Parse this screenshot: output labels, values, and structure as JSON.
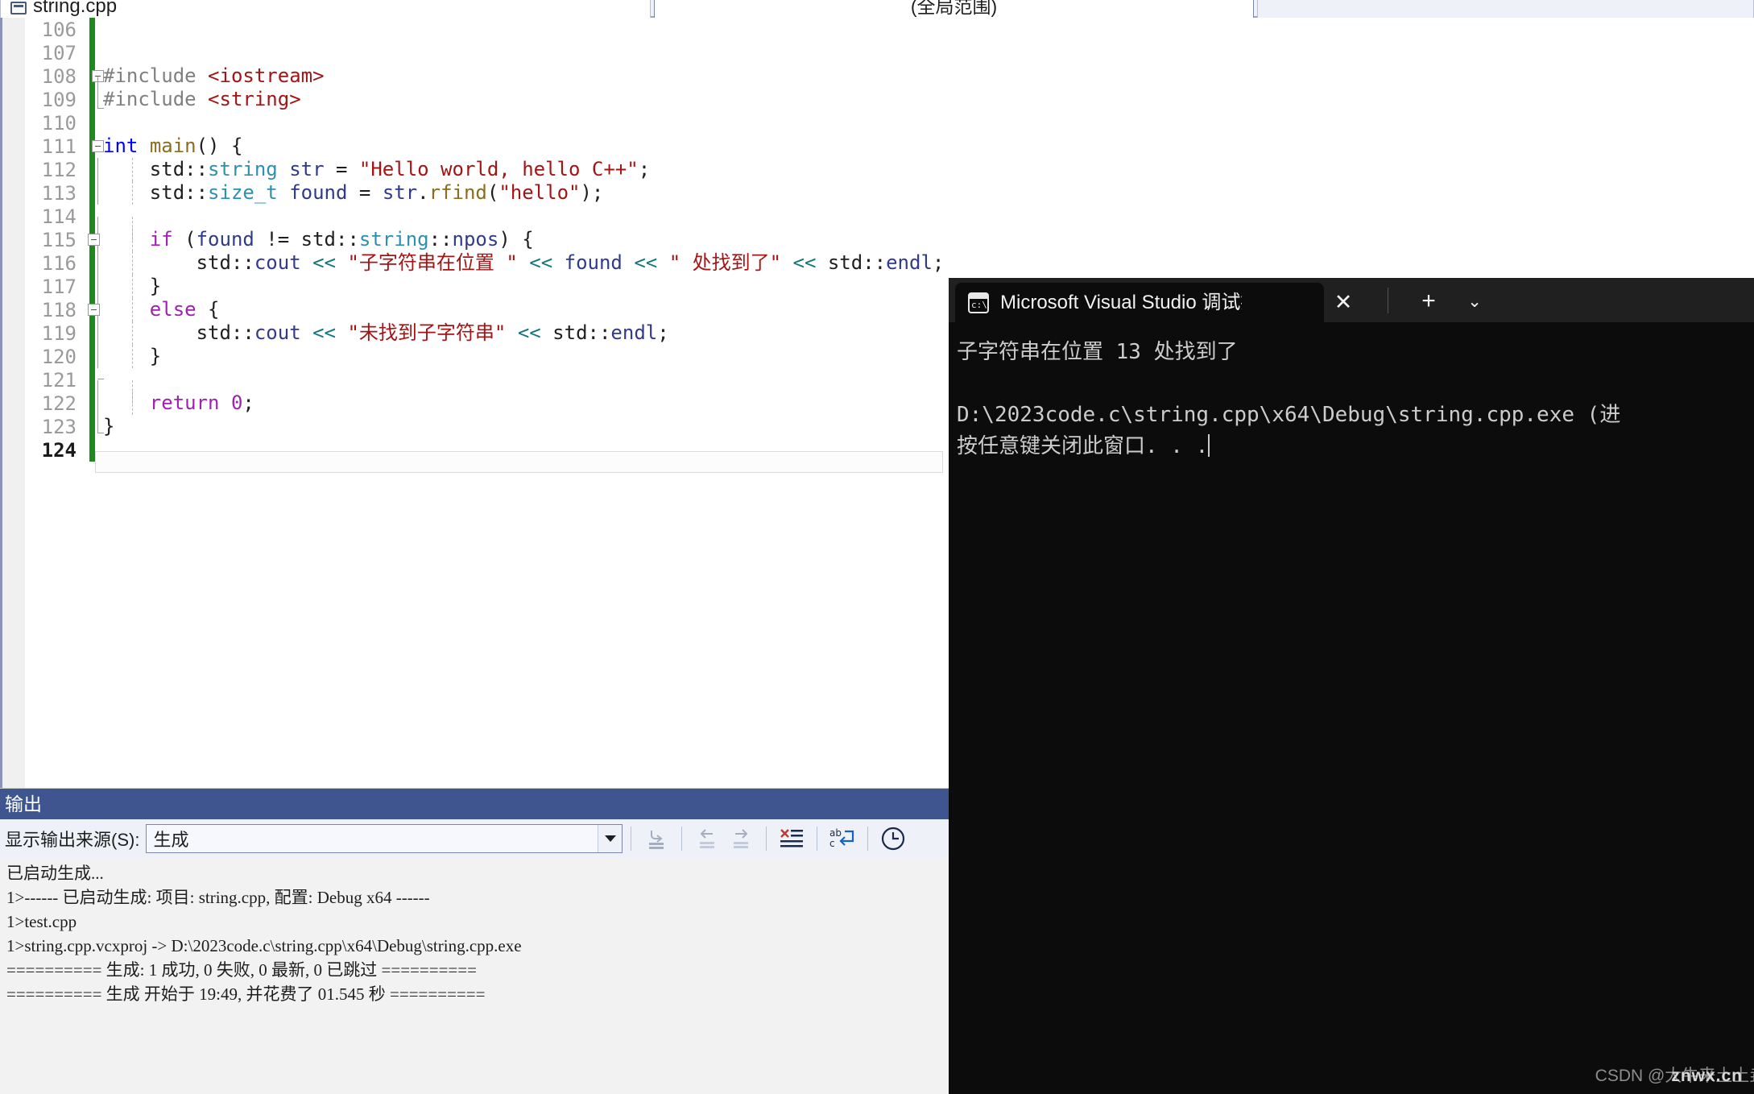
{
  "tabstrip": {
    "document_tab": "string.cpp",
    "scope_selector": "(全局范围)",
    "doc_icon": "cpp-file-icon"
  },
  "editor": {
    "lines": [
      {
        "no": "106",
        "code": ""
      },
      {
        "no": "107",
        "code": ""
      },
      {
        "no": "108",
        "code": "#include <iostream>"
      },
      {
        "no": "109",
        "code": "#include <string>"
      },
      {
        "no": "110",
        "code": ""
      },
      {
        "no": "111",
        "code": "int main() {"
      },
      {
        "no": "112",
        "code": "    std::string str = \"Hello world, hello C++\";"
      },
      {
        "no": "113",
        "code": "    std::size_t found = str.rfind(\"hello\");"
      },
      {
        "no": "114",
        "code": ""
      },
      {
        "no": "115",
        "code": "    if (found != std::string::npos) {"
      },
      {
        "no": "116",
        "code": "        std::cout << \"子字符串在位置 \" << found << \" 处找到了\" << std::endl;"
      },
      {
        "no": "117",
        "code": "    }"
      },
      {
        "no": "118",
        "code": "    else {"
      },
      {
        "no": "119",
        "code": "        std::cout << \"未找到子字符串\" << std::endl;"
      },
      {
        "no": "120",
        "code": "    }"
      },
      {
        "no": "121",
        "code": ""
      },
      {
        "no": "122",
        "code": "    return 0;"
      },
      {
        "no": "123",
        "code": "}"
      },
      {
        "no": "124",
        "code": ""
      }
    ],
    "current_line": "124"
  },
  "output_pane": {
    "title": "输出",
    "source_label": "显示输出来源(S):",
    "source_value": "生成",
    "toolbar_icons": [
      "jump-to-source-icon",
      "navigate-back-icon",
      "navigate-forward-icon",
      "clear-all-icon",
      "toggle-word-wrap-icon",
      "show-timestamps-icon"
    ],
    "lines": [
      "已启动生成...",
      "1>------ 已启动生成: 项目: string.cpp, 配置: Debug x64 ------",
      "1>test.cpp",
      "1>string.cpp.vcxproj -> D:\\2023code.c\\string.cpp\\x64\\Debug\\string.cpp.exe",
      "========== 生成: 1 成功, 0 失败, 0 最新, 0 已跳过 ==========",
      "========== 生成 开始于 19:49, 并花费了 01.545 秒 =========="
    ]
  },
  "console": {
    "tab_title": "Microsoft Visual Studio 调试控",
    "tab_icon": "console-window-icon",
    "close_label": "✕",
    "new_tab_label": "+",
    "dropdown_label": "⌄",
    "lines": [
      "子字符串在位置 13 处找到了",
      "",
      "D:\\2023code.c\\string.cpp\\x64\\Debug\\string.cpp.exe (进",
      "按任意键关闭此窗口. . ."
    ]
  },
  "watermark": {
    "primary": "CSDN @大牛来土土垚",
    "secondary": "znwx.cn"
  },
  "colors": {
    "keyword_blue": "#0000ff",
    "keyword_purple": "#a020b0",
    "type_teal": "#2b91af",
    "string_red": "#a31515",
    "operator_teal": "#15757a",
    "change_bar_green": "#1d8a1d",
    "output_title_blue": "#3f5590",
    "console_bg": "#0c0c0c"
  }
}
